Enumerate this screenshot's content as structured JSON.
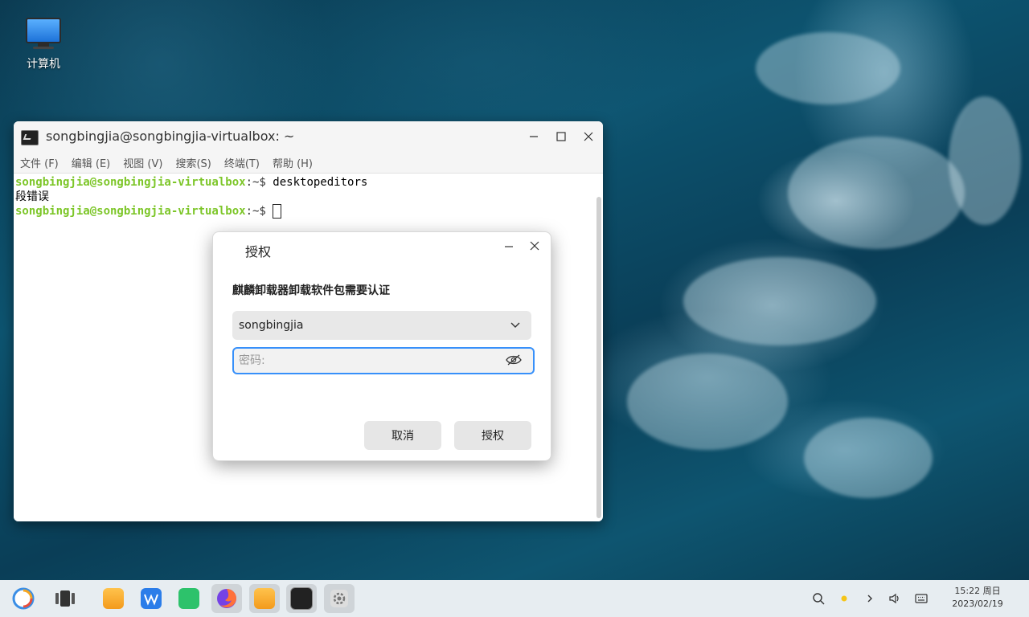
{
  "desktop": {
    "icons": [
      {
        "label": "计算机",
        "icon": "computer-icon"
      }
    ]
  },
  "terminal": {
    "title": "songbingjia@songbingjia-virtualbox: ~",
    "menu": [
      "文件 (F)",
      "编辑 (E)",
      "视图 (V)",
      "搜索(S)",
      "终端(T)",
      "帮助 (H)"
    ],
    "lines": [
      {
        "user": "songbingjia@songbingjia-virtualbox",
        "path": ":~$ ",
        "command": "desktopeditors"
      },
      {
        "output": "段错误"
      },
      {
        "user": "songbingjia@songbingjia-virtualbox",
        "path": ":~$ ",
        "command": ""
      }
    ]
  },
  "dialog": {
    "title": "授权",
    "message": "麒麟卸载器卸载软件包需要认证",
    "user": "songbingjia",
    "password_placeholder": "密码:",
    "cancel_label": "取消",
    "authorize_label": "授权",
    "accent_color": "#3790fa"
  },
  "taskbar": {
    "apps": [
      {
        "name": "start-menu",
        "icon": "kylin-start-icon"
      },
      {
        "name": "multitask-view",
        "icon": "multitask-view-icon"
      },
      {
        "name": "app-installer",
        "icon": "package-installer-icon"
      },
      {
        "name": "wps",
        "icon": "wps-icon"
      },
      {
        "name": "chat",
        "icon": "chat-icon"
      },
      {
        "name": "firefox",
        "icon": "firefox-icon"
      },
      {
        "name": "app-installer-running",
        "icon": "package-installer-icon"
      },
      {
        "name": "terminal",
        "icon": "terminal-icon"
      },
      {
        "name": "settings",
        "icon": "gear-icon"
      }
    ],
    "tray": [
      "search-icon",
      "notification-dot-icon",
      "chevron-right-icon",
      "volume-icon",
      "keyboard-icon"
    ],
    "time": "15:22 周日",
    "date": "2023/02/19"
  }
}
